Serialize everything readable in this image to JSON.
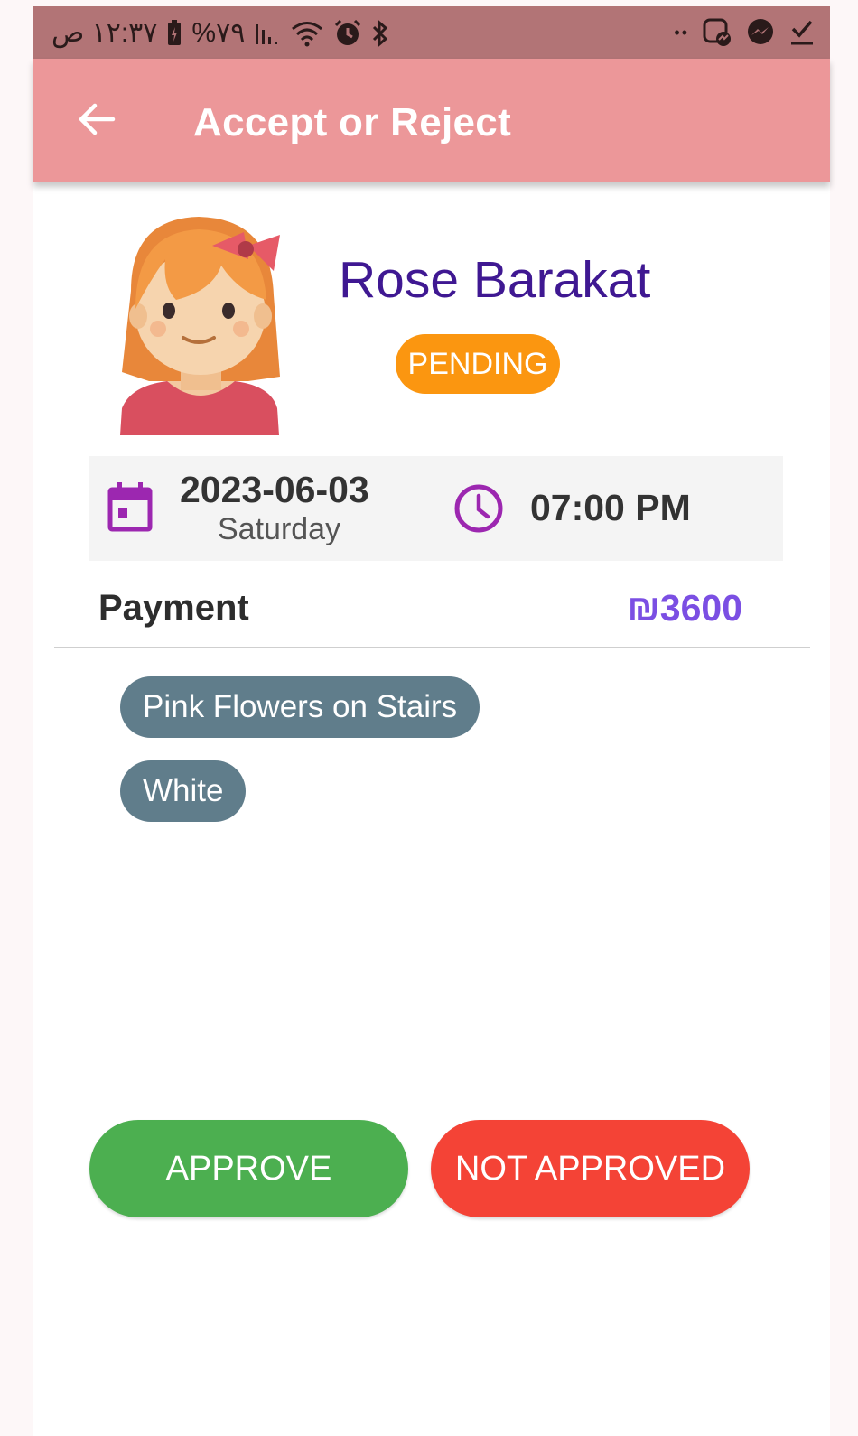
{
  "status_bar": {
    "time": "١٢:٣٧ ص",
    "battery": "%٧٩",
    "signal_icon": "signal-icon",
    "wifi_icon": "wifi-icon",
    "alarm_icon": "alarm-icon",
    "bluetooth_icon": "bluetooth-icon",
    "more": "••",
    "right_icons": [
      "messenger-chat-icon",
      "messenger-icon",
      "download-done-icon"
    ]
  },
  "app_bar": {
    "title": "Accept or Reject",
    "back_icon": "arrow-back-icon",
    "color": "#ec9799"
  },
  "profile": {
    "name": "Rose Barakat",
    "status": "PENDING",
    "status_color": "#fb9610",
    "avatar_icon": "girl-avatar"
  },
  "schedule": {
    "date": "2023-06-03",
    "day": "Saturday",
    "time": "07:00 PM",
    "date_icon": "calendar-icon",
    "time_icon": "clock-icon",
    "icon_color": "#9c27b0"
  },
  "payment": {
    "label": "Payment",
    "amount": "₪3600",
    "amount_color": "#7b4fe3"
  },
  "tags": [
    "Pink Flowers on Stairs",
    "White"
  ],
  "actions": {
    "approve": "APPROVE",
    "reject": "NOT APPROVED",
    "approve_color": "#4caf50",
    "reject_color": "#f44336"
  }
}
